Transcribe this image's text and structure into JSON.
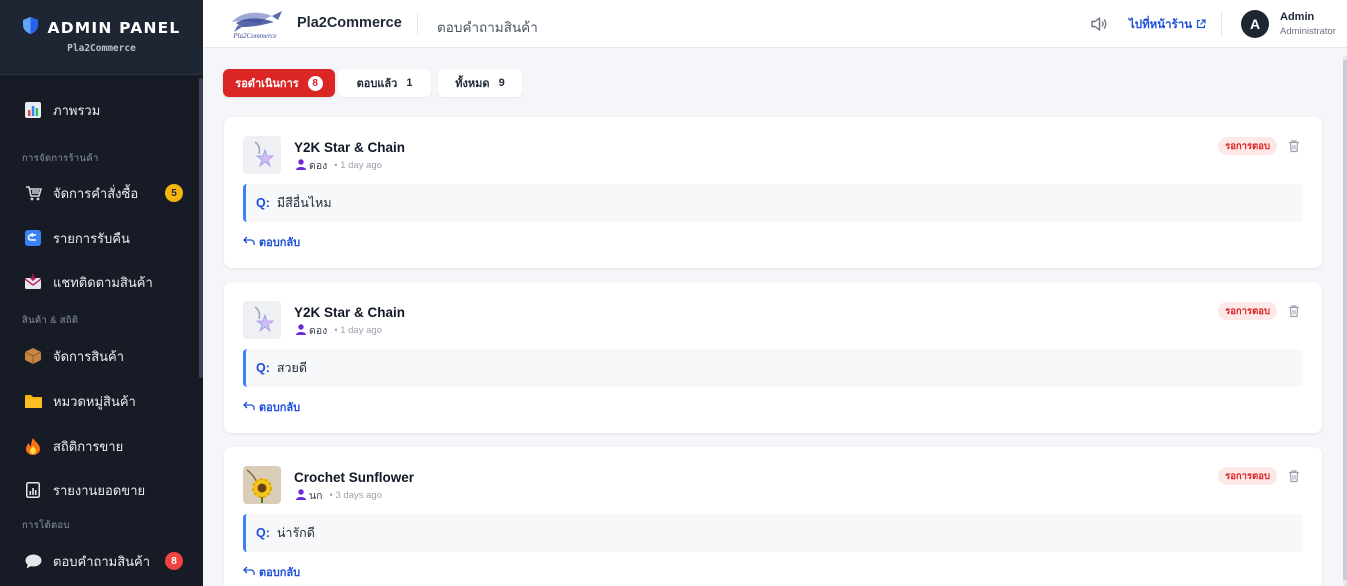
{
  "sidebar": {
    "title": "ADMIN PANEL",
    "subtitle": "Pla2Commerce",
    "items": [
      {
        "label": "ภาพรวม",
        "icon": "bar-chart-icon"
      },
      {
        "label": "จัดการคำสั่งซื้อ",
        "icon": "cart-icon",
        "badge": "5"
      },
      {
        "label": "รายการรับคืน",
        "icon": "return-icon"
      },
      {
        "label": "แชทติดตามสินค้า",
        "icon": "mail-icon"
      },
      {
        "label": "จัดการสินค้า",
        "icon": "package-icon"
      },
      {
        "label": "หมวดหมู่สินค้า",
        "icon": "folder-icon"
      },
      {
        "label": "สถิติการขาย",
        "icon": "fire-icon"
      },
      {
        "label": "รายงานยอดขาย",
        "icon": "report-icon"
      },
      {
        "label": "ตอบคำถามสินค้า",
        "icon": "speech-bubble-icon",
        "badge": "8"
      }
    ],
    "sections": [
      "การจัดการร้านค้า",
      "สินค้า & สถิติ",
      "การโต้ตอบ"
    ]
  },
  "topbar": {
    "logo_text": "Pla2Commerce",
    "store_name": "Pla2Commerce",
    "page_title": "ตอบคำถามสินค้า",
    "storefront_link": "ไปที่หน้าร้าน",
    "user_initial": "A",
    "user_name": "Admin",
    "user_role": "Administrator"
  },
  "tabs": [
    {
      "label": "รอดำเนินการ",
      "count": "8",
      "active": true
    },
    {
      "label": "ตอบแล้ว",
      "count": "1",
      "active": false
    },
    {
      "label": "ทั้งหมด",
      "count": "9",
      "active": false
    }
  ],
  "questions": [
    {
      "product": "Y2K Star & Chain",
      "user": "ดอง",
      "time": "• 1 day ago",
      "status": "รอการตอบ",
      "q_prefix": "Q:",
      "question": "มีสีอื่นไหม",
      "reply_label": "ตอบกลับ",
      "thumb": "star-keychain-thumb"
    },
    {
      "product": "Y2K Star & Chain",
      "user": "ดอง",
      "time": "• 1 day ago",
      "status": "รอการตอบ",
      "q_prefix": "Q:",
      "question": "สวยดี",
      "reply_label": "ตอบกลับ",
      "thumb": "star-keychain-thumb"
    },
    {
      "product": "Crochet Sunflower",
      "user": "นก",
      "time": "• 3 days ago",
      "status": "รอการตอบ",
      "q_prefix": "Q:",
      "question": "น่ารักดี",
      "reply_label": "ตอบกลับ",
      "thumb": "sunflower-thumb"
    }
  ],
  "colors": {
    "sidebar_bg": "#161b26",
    "accent_red": "#dc2626",
    "link_blue": "#1d4ed8",
    "badge_yellow": "#f5b50a"
  }
}
